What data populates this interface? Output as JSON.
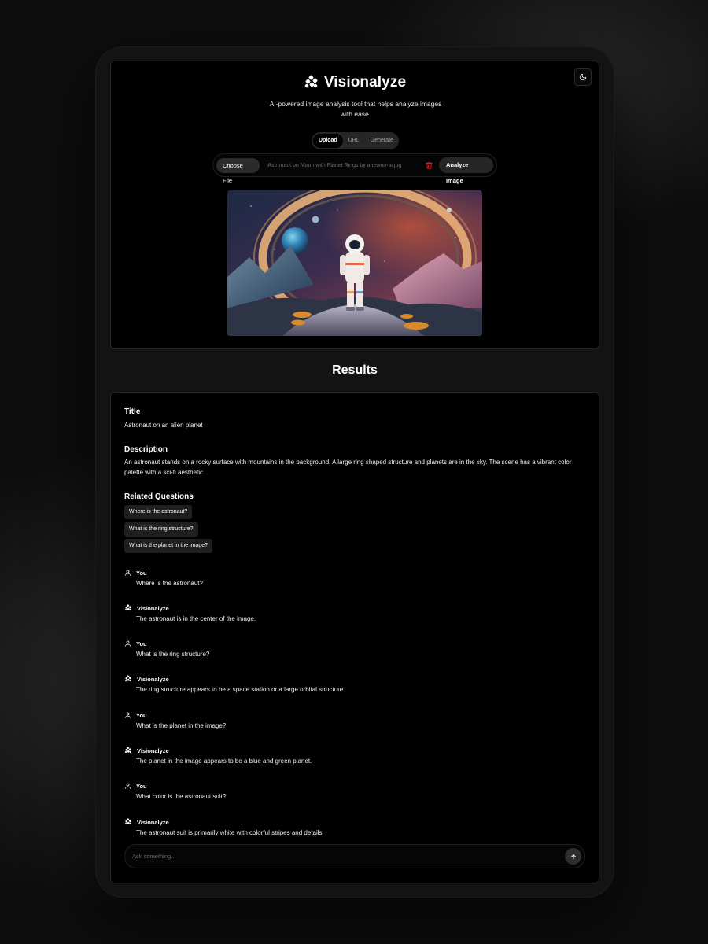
{
  "app": {
    "title": "Visionalyze",
    "tagline": "AI-powered image analysis tool that helps analyze images with ease."
  },
  "theme_toggle": {
    "icon": "moon-icon"
  },
  "tabs": [
    {
      "label": "Upload",
      "active": true
    },
    {
      "label": "URL",
      "active": false
    },
    {
      "label": "Generate",
      "active": false
    }
  ],
  "upload": {
    "choose_label": "Choose File",
    "file_name": "Astronaut on Moon with Planet Rings by anewrin-ai.jpg",
    "analyze_label": "Analyze Image",
    "delete_icon": "trash-icon"
  },
  "results": {
    "heading": "Results",
    "title_label": "Title",
    "title_value": "Astronaut on an alien planet",
    "description_label": "Description",
    "description_value": "An astronaut stands on a rocky surface with mountains in the background. A large ring shaped structure and planets are in the sky. The scene has a vibrant color palette with a sci-fi aesthetic.",
    "related_label": "Related Questions",
    "related_questions": [
      "Where is the astronaut?",
      "What is the ring structure?",
      "What is the planet in the image?"
    ]
  },
  "chat": {
    "messages": [
      {
        "role": "user",
        "name": "You",
        "text": "Where is the astronaut?"
      },
      {
        "role": "assistant",
        "name": "Visionalyze",
        "text": "The astronaut is in the center of the image."
      },
      {
        "role": "user",
        "name": "You",
        "text": "What is the ring structure?"
      },
      {
        "role": "assistant",
        "name": "Visionalyze",
        "text": "The ring structure appears to be a space station or a large orbital structure."
      },
      {
        "role": "user",
        "name": "You",
        "text": "What is the planet in the image?"
      },
      {
        "role": "assistant",
        "name": "Visionalyze",
        "text": "The planet in the image appears to be a blue and green planet."
      },
      {
        "role": "user",
        "name": "You",
        "text": "What color is the astronaut suit?"
      },
      {
        "role": "assistant",
        "name": "Visionalyze",
        "text": "The astronaut suit is primarily white with colorful stripes and details."
      }
    ],
    "input_placeholder": "Ask something...",
    "send_icon": "arrow-up-icon"
  },
  "colors": {
    "background": "#0d0d0d",
    "card": "#000000",
    "accent_delete": "#dc2626"
  }
}
